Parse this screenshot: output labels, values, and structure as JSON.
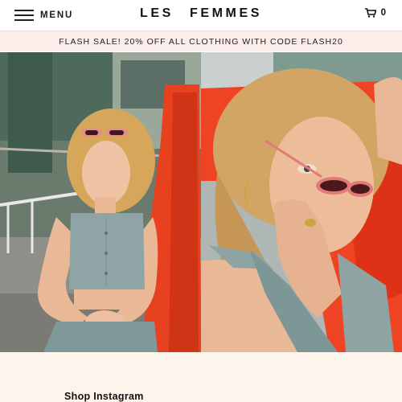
{
  "header": {
    "menu_label": "MENU",
    "logo": "LES FEMMES",
    "cart_count": "0",
    "cart_icon": "shopping-cart-icon",
    "menu_icon": "hamburger-icon"
  },
  "promo": {
    "text": "FLASH SALE! 20% OFF ALL CLOTHING WITH CODE FLASH20",
    "background": "#fbeeea"
  },
  "hero": {
    "images": [
      {
        "name": "model-in-gingham-crop-top-photo"
      },
      {
        "name": "model-with-red-sunglasses-photo"
      }
    ]
  },
  "instagram": {
    "title": "Shop Instagram",
    "background": "#fdf5ec"
  }
}
